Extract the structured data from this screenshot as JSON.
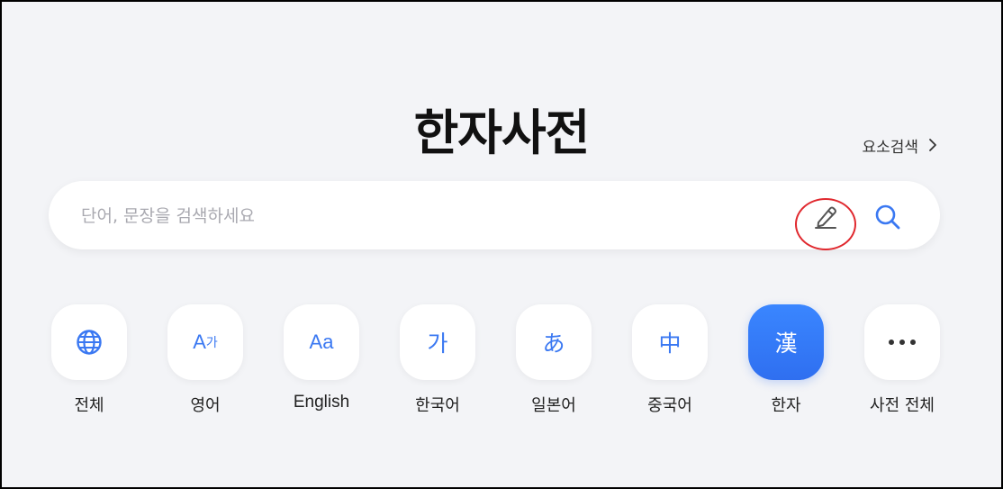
{
  "page": {
    "title": "한자사전"
  },
  "element_search": {
    "label": "요소검색",
    "icon": "chevron-right-icon"
  },
  "search": {
    "placeholder": "단어, 문장을 검색하세요",
    "value": "",
    "handwriting_icon": "pen-icon",
    "search_icon": "search-icon",
    "highlight_color": "#e0282e"
  },
  "dictionaries": [
    {
      "id": "all",
      "icon": "globe-icon",
      "label": "전체"
    },
    {
      "id": "english-ko",
      "icon_text": "A",
      "icon_sub": "가",
      "label": "영어"
    },
    {
      "id": "english",
      "icon_text": "Aa",
      "label": "English"
    },
    {
      "id": "korean",
      "icon_text": "가",
      "label": "한국어"
    },
    {
      "id": "japanese",
      "icon_text": "あ",
      "label": "일본어"
    },
    {
      "id": "chinese",
      "icon_text": "中",
      "label": "중국어"
    },
    {
      "id": "hanja",
      "icon_text": "漢",
      "label": "한자",
      "active": true
    },
    {
      "id": "more",
      "icon": "more-dots-icon",
      "label": "사전 전체"
    }
  ],
  "colors": {
    "accent": "#3a78f2",
    "active_tile": "#2f6ff0",
    "background": "#f3f4f7"
  }
}
